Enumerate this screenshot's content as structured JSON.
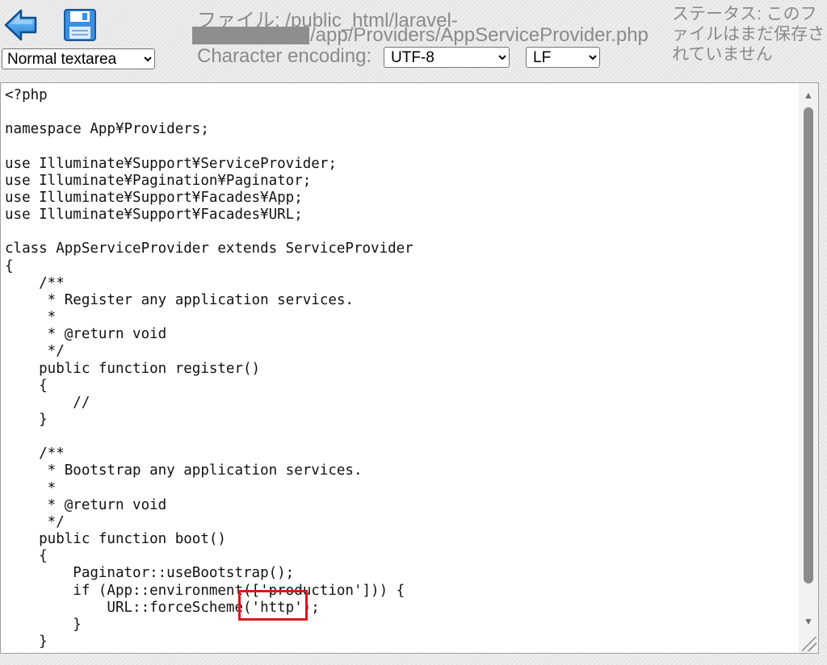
{
  "toolbar": {
    "back_icon": "back-arrow-icon",
    "save_icon": "floppy-disk-icon",
    "mode_select": {
      "value": "Normal textarea",
      "options": [
        "Normal textarea"
      ]
    },
    "file_label": "ファイル:",
    "file_path_line1": "/public_html/laravel-",
    "file_path_line2": "/app/Providers/AppServiceProvider.php",
    "encoding_label": "Character encoding:",
    "encoding_select": {
      "value": "UTF-8",
      "options": [
        "UTF-8"
      ]
    },
    "eol_select": {
      "value": "LF",
      "options": [
        "LF"
      ]
    },
    "status_text": "ステータス: このファイルはまだ保存されていません"
  },
  "editor": {
    "code": "<?php\n\nnamespace App¥Providers;\n\nuse Illuminate¥Support¥ServiceProvider;\nuse Illuminate¥Pagination¥Paginator;\nuse Illuminate¥Support¥Facades¥App;\nuse Illuminate¥Support¥Facades¥URL;\n\nclass AppServiceProvider extends ServiceProvider\n{\n    /**\n     * Register any application services.\n     *\n     * @return void\n     */\n    public function register()\n    {\n        //\n    }\n\n    /**\n     * Bootstrap any application services.\n     *\n     * @return void\n     */\n    public function boot()\n    {\n        Paginator::useBootstrap();\n        if (App::environment(['production'])) {\n            URL::forceScheme('http');\n        }\n    }",
    "highlight_color": "#e0141a"
  }
}
